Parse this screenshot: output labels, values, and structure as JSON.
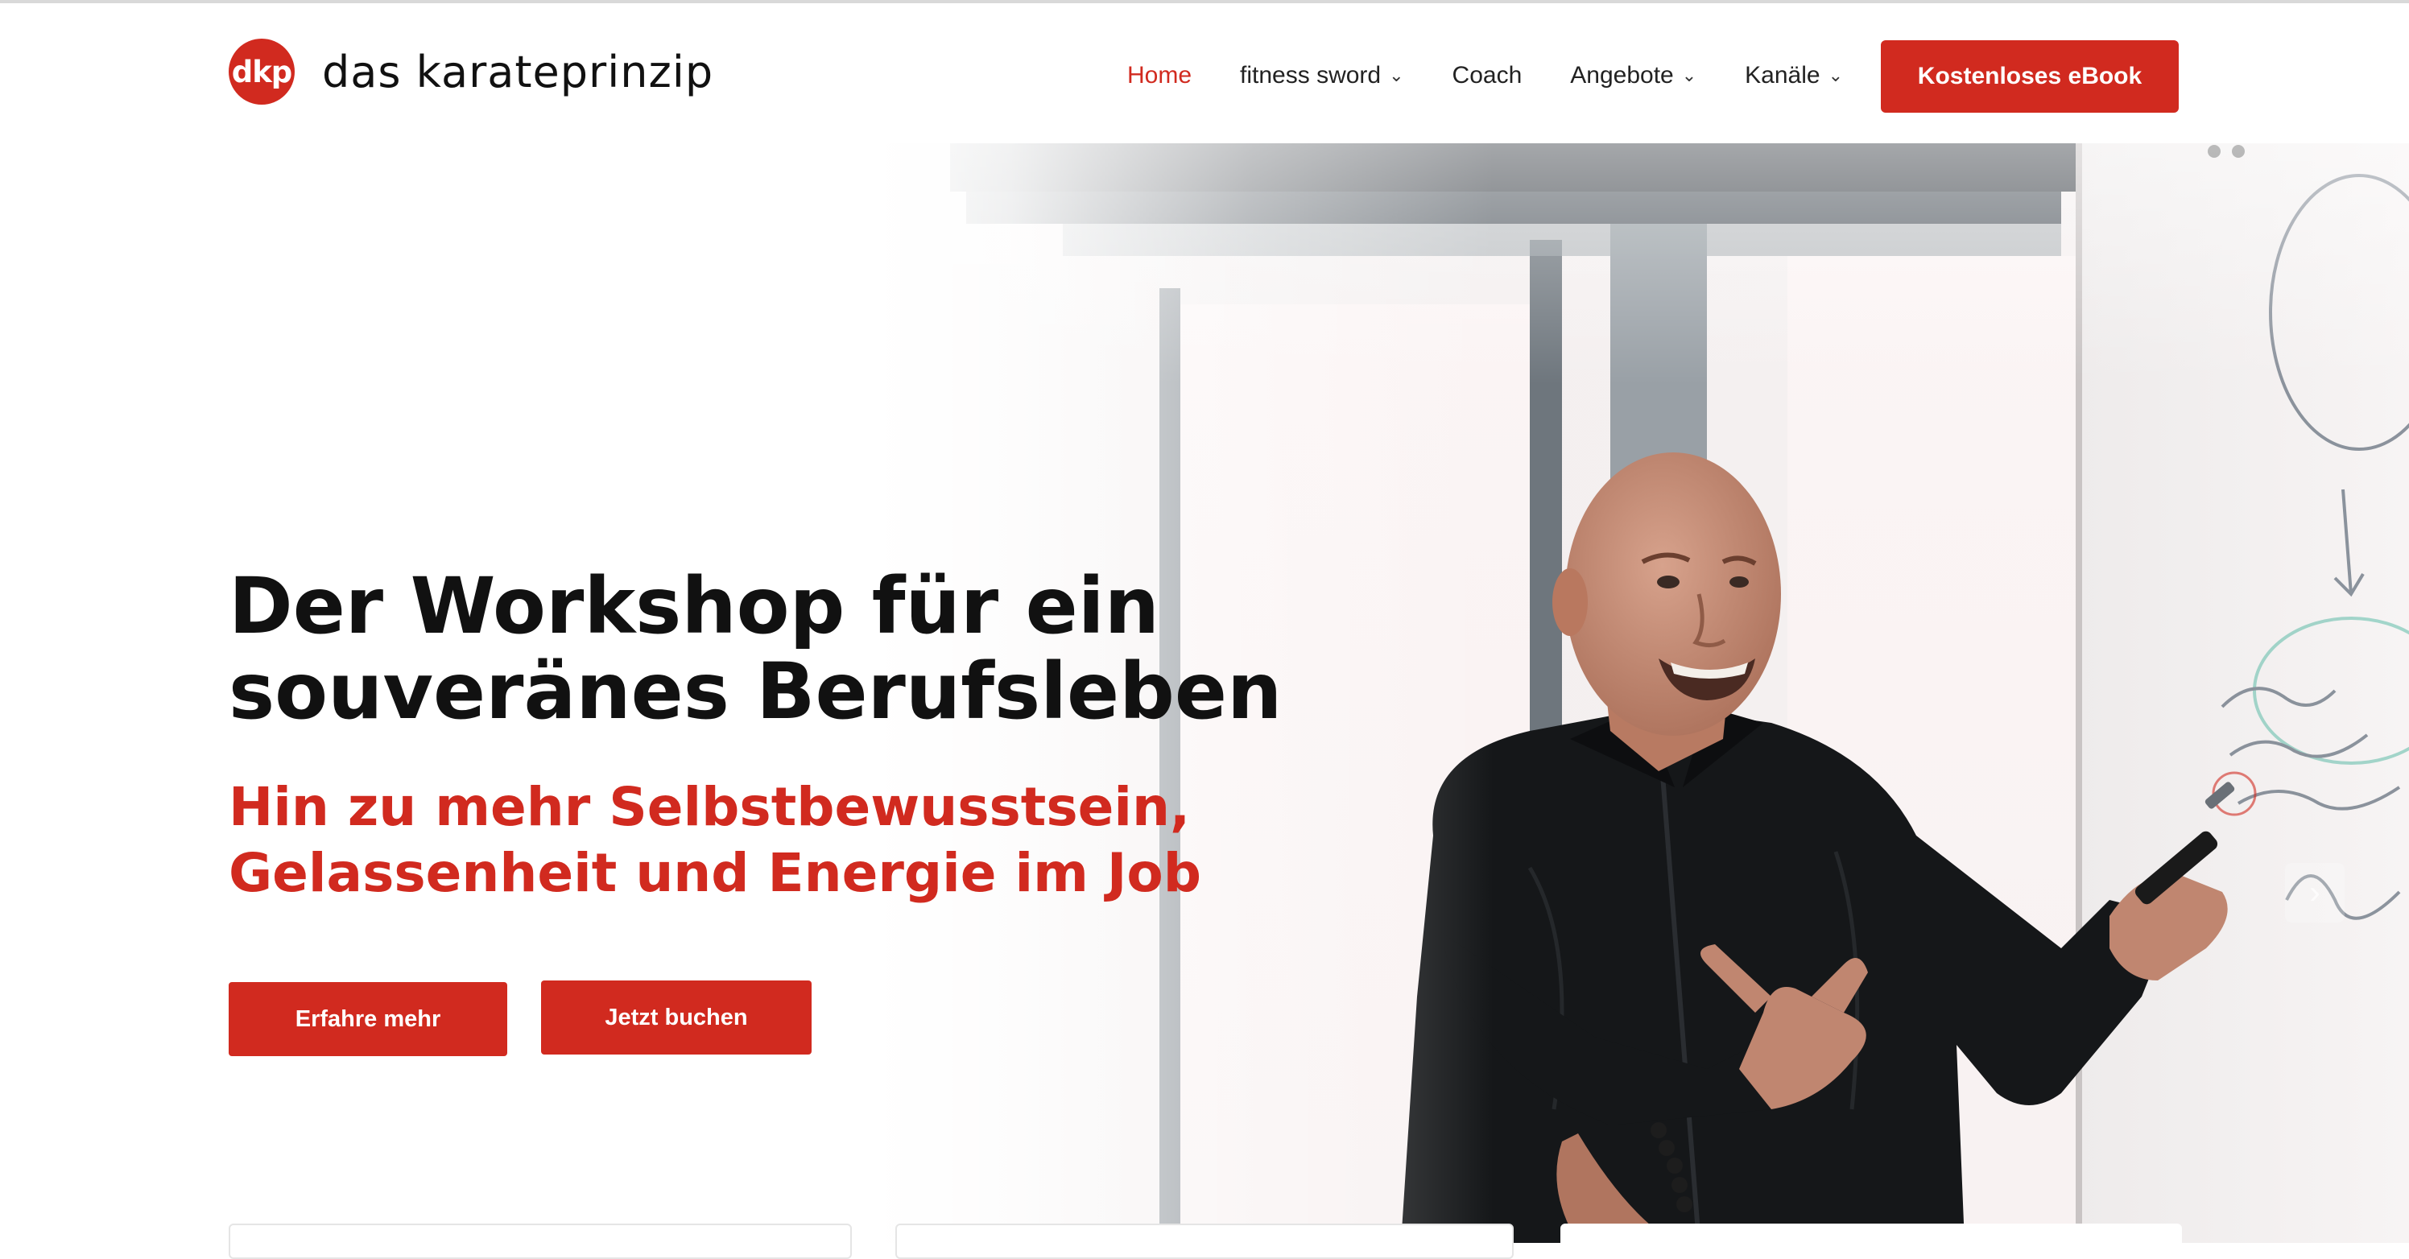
{
  "brand": {
    "logo_mark": "dkp",
    "logo_text": "das karateprinzip",
    "accent_color": "#d12a1f"
  },
  "nav": {
    "items": [
      {
        "label": "Home",
        "active": true,
        "dropdown": false
      },
      {
        "label": "fitness sword",
        "active": false,
        "dropdown": true
      },
      {
        "label": "Coach",
        "active": false,
        "dropdown": false
      },
      {
        "label": "Angebote",
        "active": false,
        "dropdown": true
      },
      {
        "label": "Kanäle",
        "active": false,
        "dropdown": true
      }
    ],
    "cta_label": "Kostenloses eBook"
  },
  "hero": {
    "title_line1": "Der Workshop für ein",
    "title_line2": "souveränes Berufsleben",
    "subtitle_line1": "Hin zu mehr Selbstbewusstsein,",
    "subtitle_line2": "Gelassenheit und Energie im Job",
    "primary_button": "Erfahre mehr",
    "secondary_button": "Jetzt buchen",
    "image_subject": "coach presenting in front of flipchart"
  },
  "icons": {
    "chevron": "chevron-down-icon",
    "slider_next": "chevron-right-icon"
  }
}
